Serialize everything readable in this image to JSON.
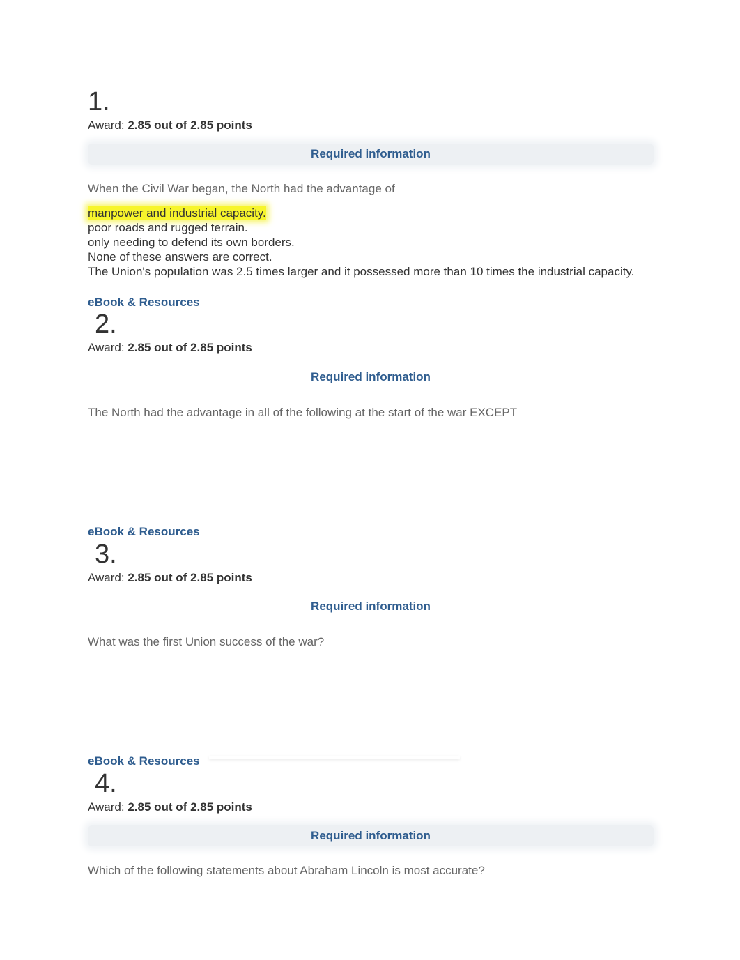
{
  "award_label": "Award:",
  "required_info_label": "Required information",
  "ebook_label": "eBook & Resources",
  "questions": [
    {
      "number": "1.",
      "score": "2.85 out of 2.85 points",
      "prompt": "When the Civil War began, the North had the advantage of",
      "answers": [
        "manpower and industrial capacity.",
        "poor roads and rugged terrain.",
        "only needing to defend its own borders.",
        "None of these answers are correct."
      ],
      "selected_answer_index": 0,
      "explanation": "The Union's population was 2.5 times larger and it possessed more than 10 times the industrial capacity."
    },
    {
      "number": "2.",
      "score": "2.85 out of 2.85 points",
      "prompt": "The North had the advantage in all of the following at the start of the war EXCEPT"
    },
    {
      "number": "3.",
      "score": "2.85 out of 2.85 points",
      "prompt": "What was the first Union success of the war?"
    },
    {
      "number": "4.",
      "score": "2.85 out of 2.85 points",
      "prompt": "Which of the following statements about Abraham Lincoln is most accurate?"
    }
  ],
  "colors": {
    "link_blue": "#2f5d8f",
    "highlight": "#f7f52c",
    "prompt_gray": "#666666"
  }
}
